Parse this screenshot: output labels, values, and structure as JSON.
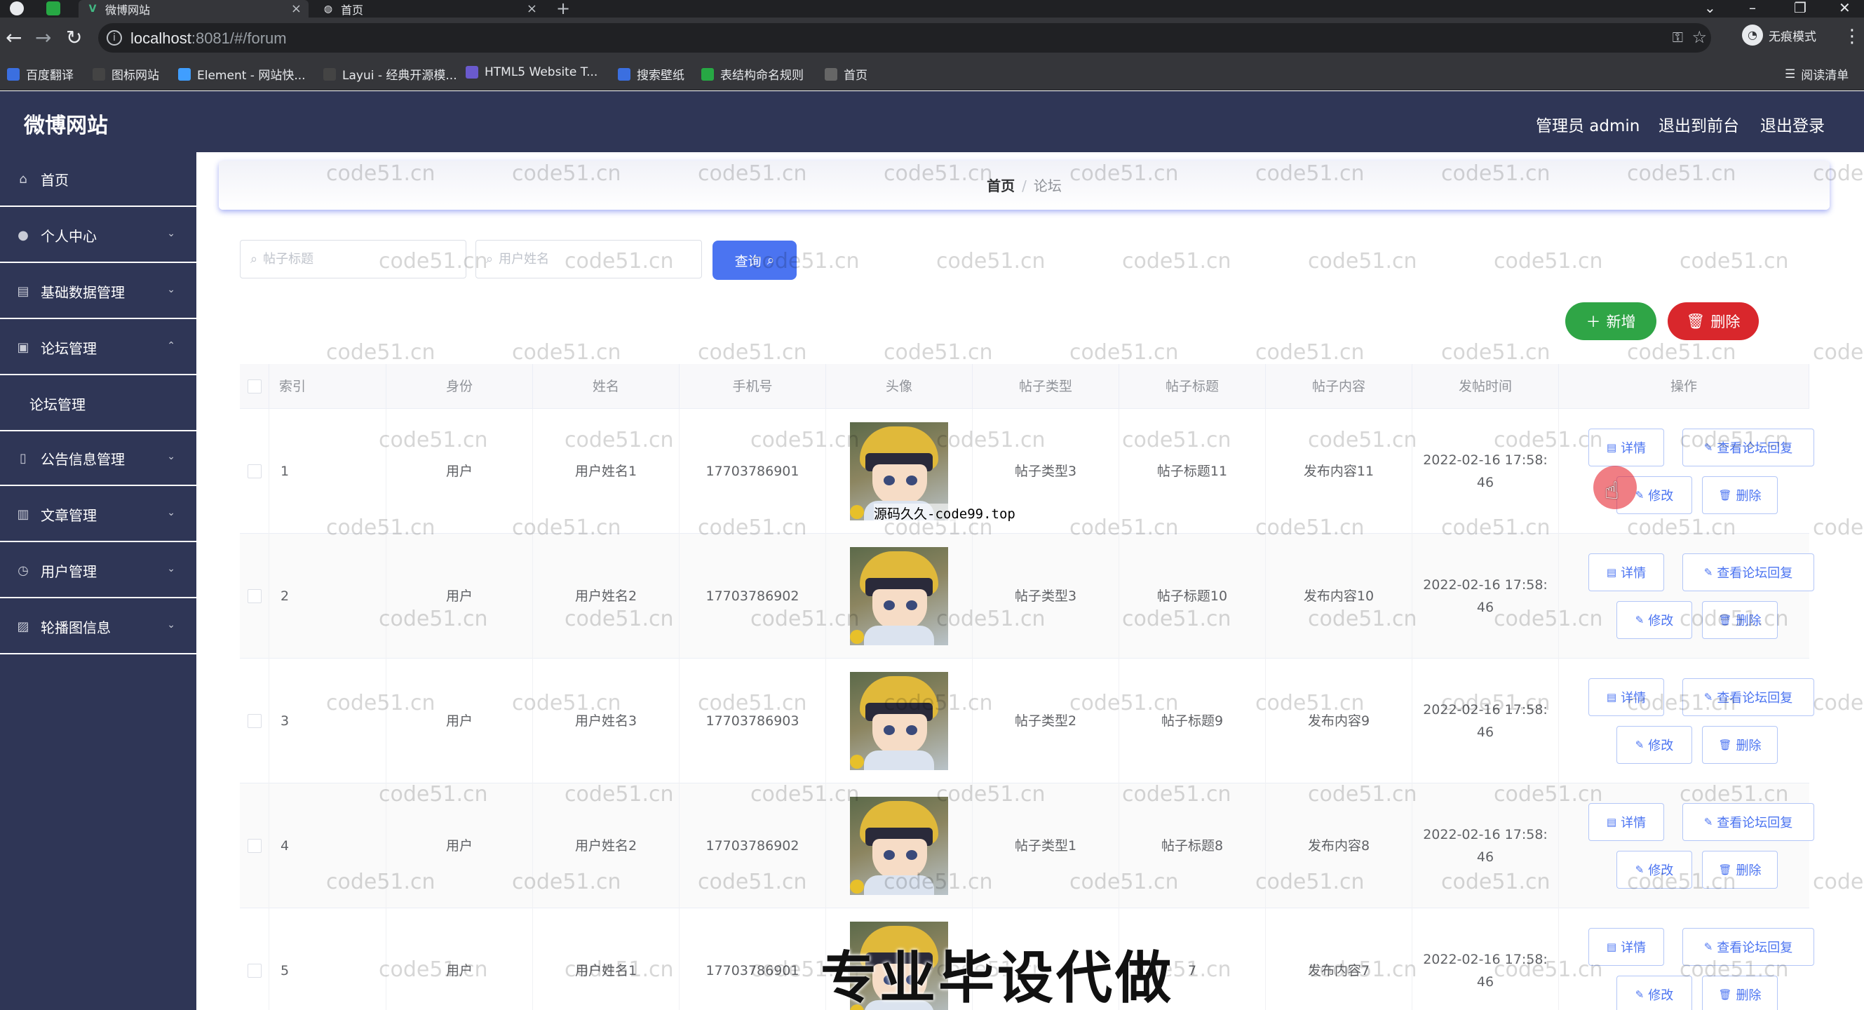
{
  "browser": {
    "tabs": [
      {
        "title": "微博网站",
        "active": true
      },
      {
        "title": "首页",
        "active": false
      }
    ],
    "url_host": "localhost",
    "url_rest": ":8081/#/forum",
    "incognito_label": "无痕模式",
    "bookmarks": [
      {
        "label": "百度翻译",
        "icon": "translate-icon",
        "color": "#3b6fe0"
      },
      {
        "label": "图标网站",
        "icon": "flag-icon",
        "color": "#444"
      },
      {
        "label": "Element - 网站快...",
        "icon": "element-icon",
        "color": "#409eff"
      },
      {
        "label": "Layui - 经典开源模...",
        "icon": "layui-icon",
        "color": "#444"
      },
      {
        "label": "HTML5 Website T...",
        "icon": "html5-icon",
        "color": "#6a5acd"
      },
      {
        "label": "搜索壁纸",
        "icon": "wallpaper-icon",
        "color": "#3b6fe0"
      },
      {
        "label": "表结构命名规则",
        "icon": "table-icon",
        "color": "#27a844"
      },
      {
        "label": "首页",
        "icon": "globe-icon",
        "color": "#666"
      }
    ],
    "reading_list": "阅读清单"
  },
  "app": {
    "title": "微博网站",
    "header_links": {
      "admin": "管理员 admin",
      "front": "退出到前台",
      "logout": "退出登录"
    }
  },
  "sidebar": {
    "items": [
      {
        "label": "首页",
        "icon": "home-icon",
        "arrow": ""
      },
      {
        "label": "个人中心",
        "icon": "user-icon",
        "arrow": "⌄"
      },
      {
        "label": "基础数据管理",
        "icon": "data-icon",
        "arrow": "⌄"
      },
      {
        "label": "论坛管理",
        "icon": "forum-icon",
        "arrow": "⌃"
      },
      {
        "label": "公告信息管理",
        "icon": "notice-icon",
        "arrow": "⌄"
      },
      {
        "label": "文章管理",
        "icon": "article-icon",
        "arrow": "⌄"
      },
      {
        "label": "用户管理",
        "icon": "users-icon",
        "arrow": "⌄"
      },
      {
        "label": "轮播图信息",
        "icon": "carousel-icon",
        "arrow": "⌄"
      }
    ],
    "submenu_forum": "论坛管理"
  },
  "breadcrumb": {
    "home": "首页",
    "separator": "/",
    "current": "论坛"
  },
  "search": {
    "title_placeholder": "帖子标题",
    "name_placeholder": "用户姓名",
    "query_label": "查询"
  },
  "actions": {
    "add_label": "新增",
    "delete_label": "删除"
  },
  "table": {
    "columns": [
      "索引",
      "身份",
      "姓名",
      "手机号",
      "头像",
      "帖子类型",
      "帖子标题",
      "帖子内容",
      "发帖时间",
      "操作"
    ],
    "row_buttons": {
      "detail": "详情",
      "replies": "查看论坛回复",
      "edit": "修改",
      "delete": "删除"
    },
    "rows": [
      {
        "index": "1",
        "role": "用户",
        "name": "用户姓名1",
        "phone": "17703786901",
        "type": "帖子类型3",
        "title": "帖子标题11",
        "content": "发布内容11",
        "time": "2022-02-16 17:58:\n46"
      },
      {
        "index": "2",
        "role": "用户",
        "name": "用户姓名2",
        "phone": "17703786902",
        "type": "帖子类型3",
        "title": "帖子标题10",
        "content": "发布内容10",
        "time": "2022-02-16 17:58:\n46"
      },
      {
        "index": "3",
        "role": "用户",
        "name": "用户姓名3",
        "phone": "17703786903",
        "type": "帖子类型2",
        "title": "帖子标题9",
        "content": "发布内容9",
        "time": "2022-02-16 17:58:\n46"
      },
      {
        "index": "4",
        "role": "用户",
        "name": "用户姓名2",
        "phone": "17703786902",
        "type": "帖子类型1",
        "title": "帖子标题8",
        "content": "发布内容8",
        "time": "2022-02-16 17:58:\n46"
      },
      {
        "index": "5",
        "role": "用户",
        "name": "用户姓名1",
        "phone": "17703786901",
        "type": "",
        "title": "7",
        "content": "发布内容7",
        "time": "2022-02-16 17:58:\n46"
      }
    ]
  },
  "overlays": {
    "watermark": "code51.cn",
    "small_text": "源码久久-code99.top",
    "big_text": "专业毕设代做"
  }
}
